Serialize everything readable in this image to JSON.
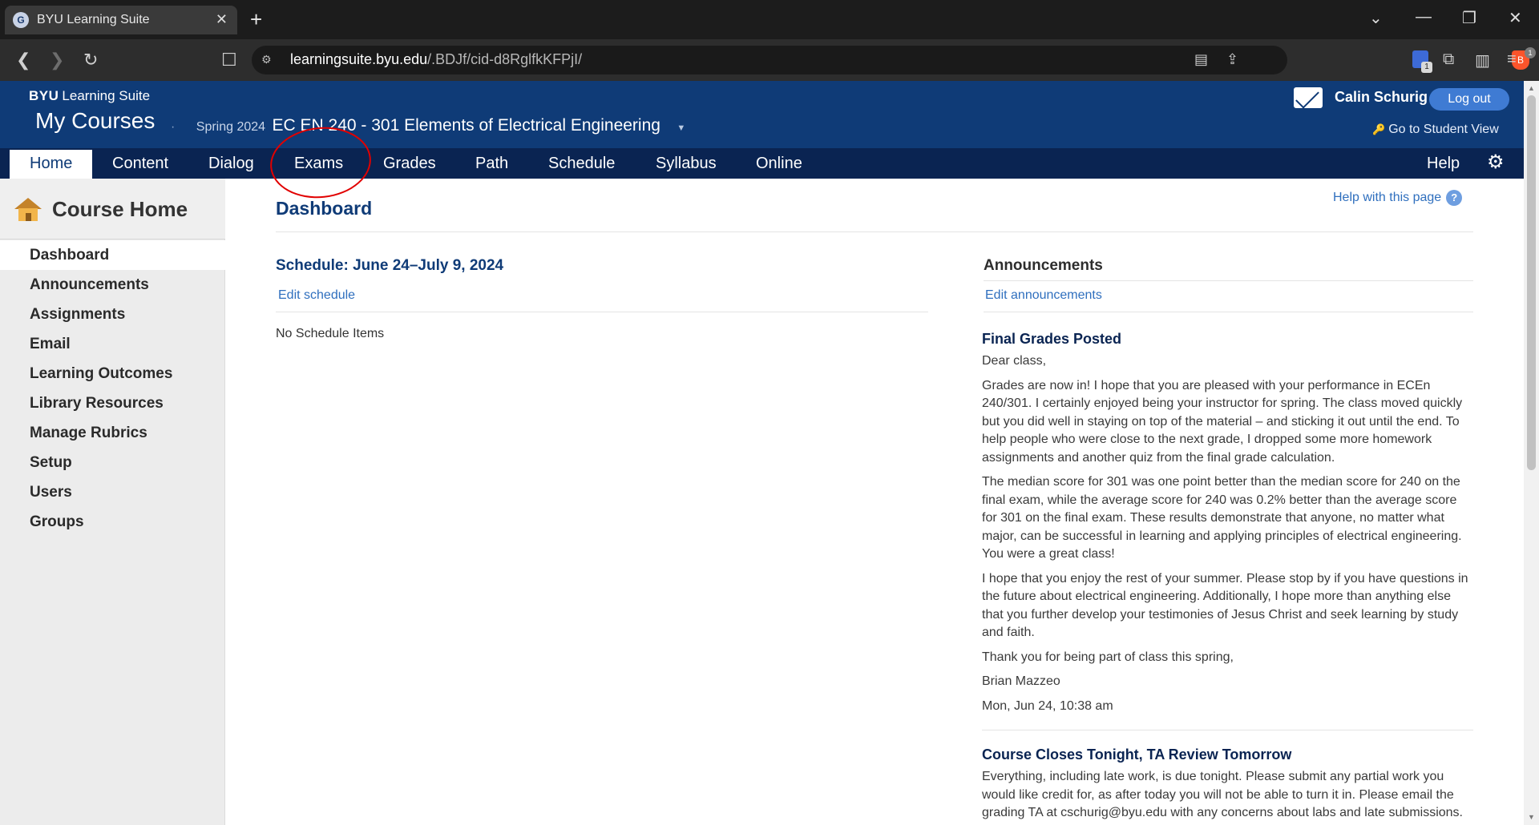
{
  "browser": {
    "tab_title": "BYU Learning Suite",
    "url_host": "learningsuite.byu.edu",
    "url_path": "/.BDJf/cid-d8RglfkKFPjI/",
    "brave_badge": "1",
    "ext_badge": "1"
  },
  "header": {
    "brand_bold": "BYU",
    "brand_rest": "Learning Suite",
    "my_courses": "My Courses",
    "term": "Spring 2024",
    "course_title": "EC EN 240 - 301 Elements of Electrical Engineering",
    "user_name": "Calin Schurig",
    "logout": "Log out",
    "student_view": "Go to Student View"
  },
  "nav": {
    "items": [
      "Home",
      "Content",
      "Dialog",
      "Exams",
      "Grades",
      "Path",
      "Schedule",
      "Syllabus",
      "Online"
    ],
    "help": "Help"
  },
  "sidebar": {
    "title": "Course Home",
    "items": [
      "Dashboard",
      "Announcements",
      "Assignments",
      "Email",
      "Learning Outcomes",
      "Library Resources",
      "Manage Rubrics",
      "Setup",
      "Users",
      "Groups"
    ]
  },
  "main": {
    "title": "Dashboard",
    "help_link": "Help with this page",
    "schedule_title": "Schedule: June 24–July 9, 2024",
    "edit_schedule": "Edit schedule",
    "no_items": "No Schedule Items",
    "announcements_title": "Announcements",
    "edit_announcements": "Edit announcements",
    "announcements": [
      {
        "title": "Final Grades Posted",
        "paragraphs": [
          "Dear class,",
          "Grades are now in! I hope that you are pleased with your performance in ECEn 240/301. I certainly enjoyed being your instructor for spring. The class moved quickly but you did well in staying on top of the material – and sticking it out until the end. To help people who were close to the next grade, I dropped some more homework assignments and another quiz from the final grade calculation.",
          "The median score for 301 was one point better than the median score for 240 on the final exam, while the average score for 240 was 0.2% better than the average score for 301 on the final exam. These results demonstrate that anyone, no matter what major, can be successful in learning and applying principles of electrical engineering. You were a great class!",
          "I hope that you enjoy the rest of your summer. Please stop by if you have questions in the future about electrical engineering. Additionally, I hope more than anything else that you further develop your testimonies of Jesus Christ and seek learning by study and faith.",
          "Thank you for being part of class this spring,",
          "Brian Mazzeo",
          "Mon, Jun 24, 10:38 am"
        ]
      },
      {
        "title": "Course Closes Tonight, TA Review Tomorrow",
        "paragraphs": [
          "Everything, including late work, is due tonight. Please submit any partial work you would like credit for, as after today you will not be able to turn it in. Please email the grading TA at cschurig@byu.edu with any concerns about labs and late submissions."
        ]
      }
    ]
  },
  "colors": {
    "header_bg": "#0f3b77",
    "nav_bg": "#0a2452",
    "link": "#2f6fbe",
    "annotation": "#e10000"
  }
}
